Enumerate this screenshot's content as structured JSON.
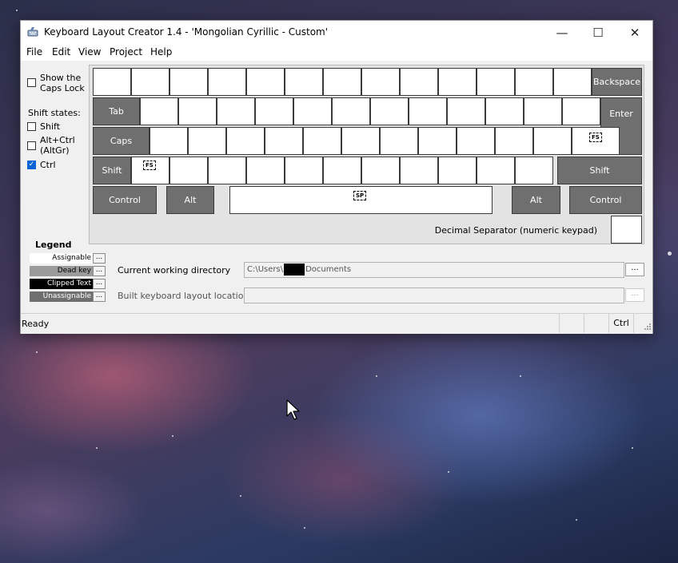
{
  "window": {
    "title": "Keyboard Layout Creator 1.4 - 'Mongolian Cyrillic - Custom'",
    "minimize_glyph": "—",
    "maximize_glyph": "☐",
    "close_glyph": "✕"
  },
  "menu": [
    "File",
    "Edit",
    "View",
    "Project",
    "Help"
  ],
  "options": {
    "show_caps_lock_line1": "Show the",
    "show_caps_lock_line2": "Caps Lock",
    "shift_states_label": "Shift states:",
    "shift": "Shift",
    "altgr_line1": "Alt+Ctrl",
    "altgr_line2": "(AltGr)",
    "ctrl": "Ctrl",
    "ctrl_checked": true
  },
  "keyboard": {
    "backspace": "Backspace",
    "tab": "Tab",
    "enter": "Enter",
    "caps": "Caps",
    "shift_left": "Shift",
    "shift_right": "Shift",
    "control_left": "Control",
    "alt_left": "Alt",
    "alt_right": "Alt",
    "control_right": "Control",
    "mark_fs": "FS",
    "mark_sp": "SP",
    "decimal_separator_label": "Decimal Separator (numeric keypad)"
  },
  "legend": {
    "title": "Legend",
    "items": [
      {
        "label": "Assignable",
        "bg": "#ffffff",
        "fg": "#000000"
      },
      {
        "label": "Dead key",
        "bg": "#9b9b9b",
        "fg": "#000000"
      },
      {
        "label": "Clipped Text",
        "bg": "#000000",
        "fg": "#ffffff"
      },
      {
        "label": "Unassignable",
        "bg": "#6f6f6f",
        "fg": "#ffffff"
      }
    ],
    "button_label": "..."
  },
  "directories": {
    "cwd_label": "Current working directory",
    "cwd_prefix": "C:\\Users\\",
    "cwd_suffix": "Documents",
    "build_label": "Built keyboard layout location",
    "build_value": "",
    "browse_label": "..."
  },
  "status": {
    "text": "Ready",
    "ctrl": "Ctrl"
  },
  "colors": {
    "unassignable_key": "#6f6f6f",
    "accent": "#0a64d6"
  }
}
